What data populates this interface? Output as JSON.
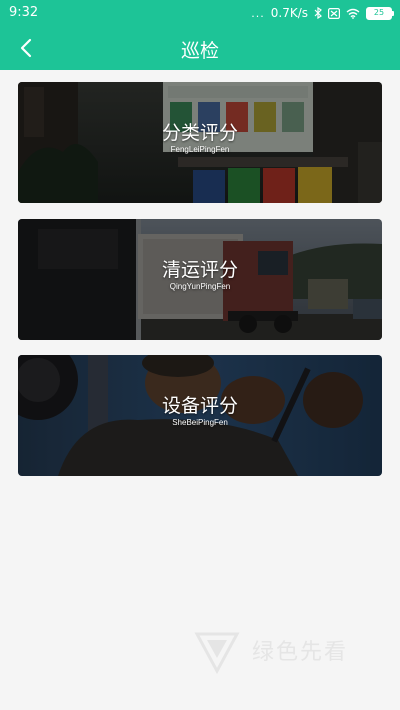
{
  "status_bar": {
    "time": "9:32",
    "dots": "...",
    "speed": "0.7K/s",
    "battery": "25",
    "icons": [
      "bluetooth-icon",
      "sim-off-icon",
      "wifi-icon",
      "battery-icon"
    ]
  },
  "header": {
    "title": "巡检",
    "back_icon": "chevron-left-icon"
  },
  "cards": [
    {
      "title": "分类评分",
      "subtitle": "FengLeiPingFen",
      "image": "garbage-bins-photo"
    },
    {
      "title": "清运评分",
      "subtitle": "QingYunPingFen",
      "image": "truck-photo"
    },
    {
      "title": "设备评分",
      "subtitle": "SheBeiPingFen",
      "image": "worker-photo"
    }
  ],
  "watermark": {
    "text": "绿色先看"
  },
  "colors": {
    "accent": "#1dc497",
    "background": "#f5f5f5"
  }
}
